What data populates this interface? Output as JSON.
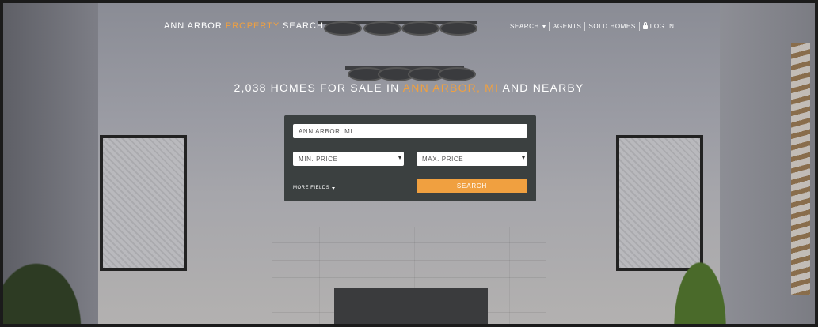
{
  "brand": {
    "part1": "ANN ARBOR ",
    "accent": "PROPERTY",
    "part2": " SEARCH"
  },
  "nav": {
    "search": "SEARCH",
    "agents": "AGENTS",
    "sold_homes": "SOLD HOMES",
    "login": "LOG IN"
  },
  "headline": {
    "count": "2,038 HOMES FOR SALE IN ",
    "location": "ANN ARBOR, MI",
    "suffix": " AND NEARBY"
  },
  "search_form": {
    "location_value": "ANN ARBOR, MI",
    "min_price_label": "MIN. PRICE",
    "max_price_label": "MAX. PRICE",
    "more_fields": "MORE FIELDS",
    "search_button": "SEARCH"
  },
  "colors": {
    "accent": "#f0a040",
    "panel": "#3b4040"
  },
  "icons": [
    "lock-icon",
    "chevron-down-icon"
  ]
}
